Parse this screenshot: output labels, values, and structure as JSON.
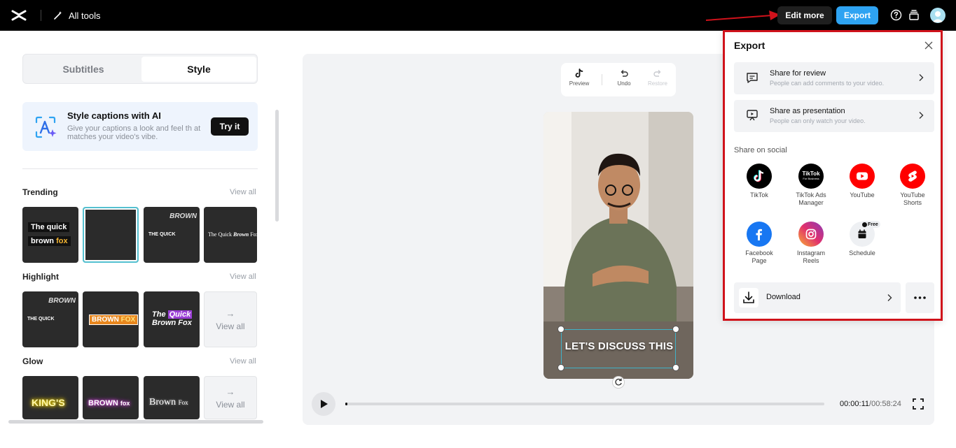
{
  "topbar": {
    "all_tools_label": "All tools",
    "edit_more_label": "Edit more",
    "export_label": "Export"
  },
  "left_panel": {
    "tabs": [
      {
        "label": "Subtitles",
        "active": false
      },
      {
        "label": "Style",
        "active": true
      }
    ],
    "ai_card": {
      "title": "Style captions with AI",
      "description": "Give your captions a look and feel th at matches your video's vibe.",
      "button_label": "Try it"
    },
    "sections": [
      {
        "title": "Trending",
        "view_all": "View all",
        "tiles": [
          "The quick brown fox",
          "",
          "BROWN THE QUICK",
          "The Quick Brown Fox"
        ]
      },
      {
        "title": "Highlight",
        "view_all": "View all",
        "tiles": [
          "BROWN THE QUICK",
          "BROWN FOX",
          "The Quick Brown Fox"
        ],
        "view_all_tile": "View all"
      },
      {
        "title": "Glow",
        "view_all": "View all",
        "tiles": [
          "KING'S",
          "BROWN fox",
          "Brown Fox"
        ],
        "view_all_tile": "View all"
      }
    ]
  },
  "editor": {
    "toolbar": {
      "preview": "Preview",
      "undo": "Undo",
      "restore": "Restore"
    },
    "caption_text": "LET'S DISCUSS THIS",
    "time_current": "00:00:11",
    "time_total": "/00:58:24",
    "progress": 0.0032
  },
  "export_panel": {
    "title": "Export",
    "share_options": [
      {
        "label": "Share for review",
        "description": "People can add comments to your video.",
        "icon": "comment-icon"
      },
      {
        "label": "Share as presentation",
        "description": "People can only watch your video.",
        "icon": "presentation-icon"
      }
    ],
    "social_title": "Share on social",
    "social": [
      {
        "label": "TikTok",
        "icon": "tiktok-icon",
        "color": "#000000"
      },
      {
        "label": "TikTok Ads Manager",
        "icon": "tiktok-ads-icon",
        "color": "#000000",
        "badge_text": "TikTok",
        "badge_sub": "For Business"
      },
      {
        "label": "YouTube",
        "icon": "youtube-icon",
        "color": "#ff0000"
      },
      {
        "label": "YouTube Shorts",
        "icon": "youtube-shorts-icon",
        "color": "#ff0000"
      },
      {
        "label": "Facebook Page",
        "icon": "facebook-icon",
        "color": "#1877f2"
      },
      {
        "label": "Instagram Reels",
        "icon": "instagram-icon",
        "color": "#e1306c"
      },
      {
        "label": "Schedule",
        "icon": "calendar-icon",
        "color": "#eef0f3",
        "badge": "Free"
      }
    ],
    "download_label": "Download"
  },
  "colors": {
    "accent": "#2ea3f2",
    "highlight_border": "#d0121b",
    "topbar_bg": "#000000"
  }
}
